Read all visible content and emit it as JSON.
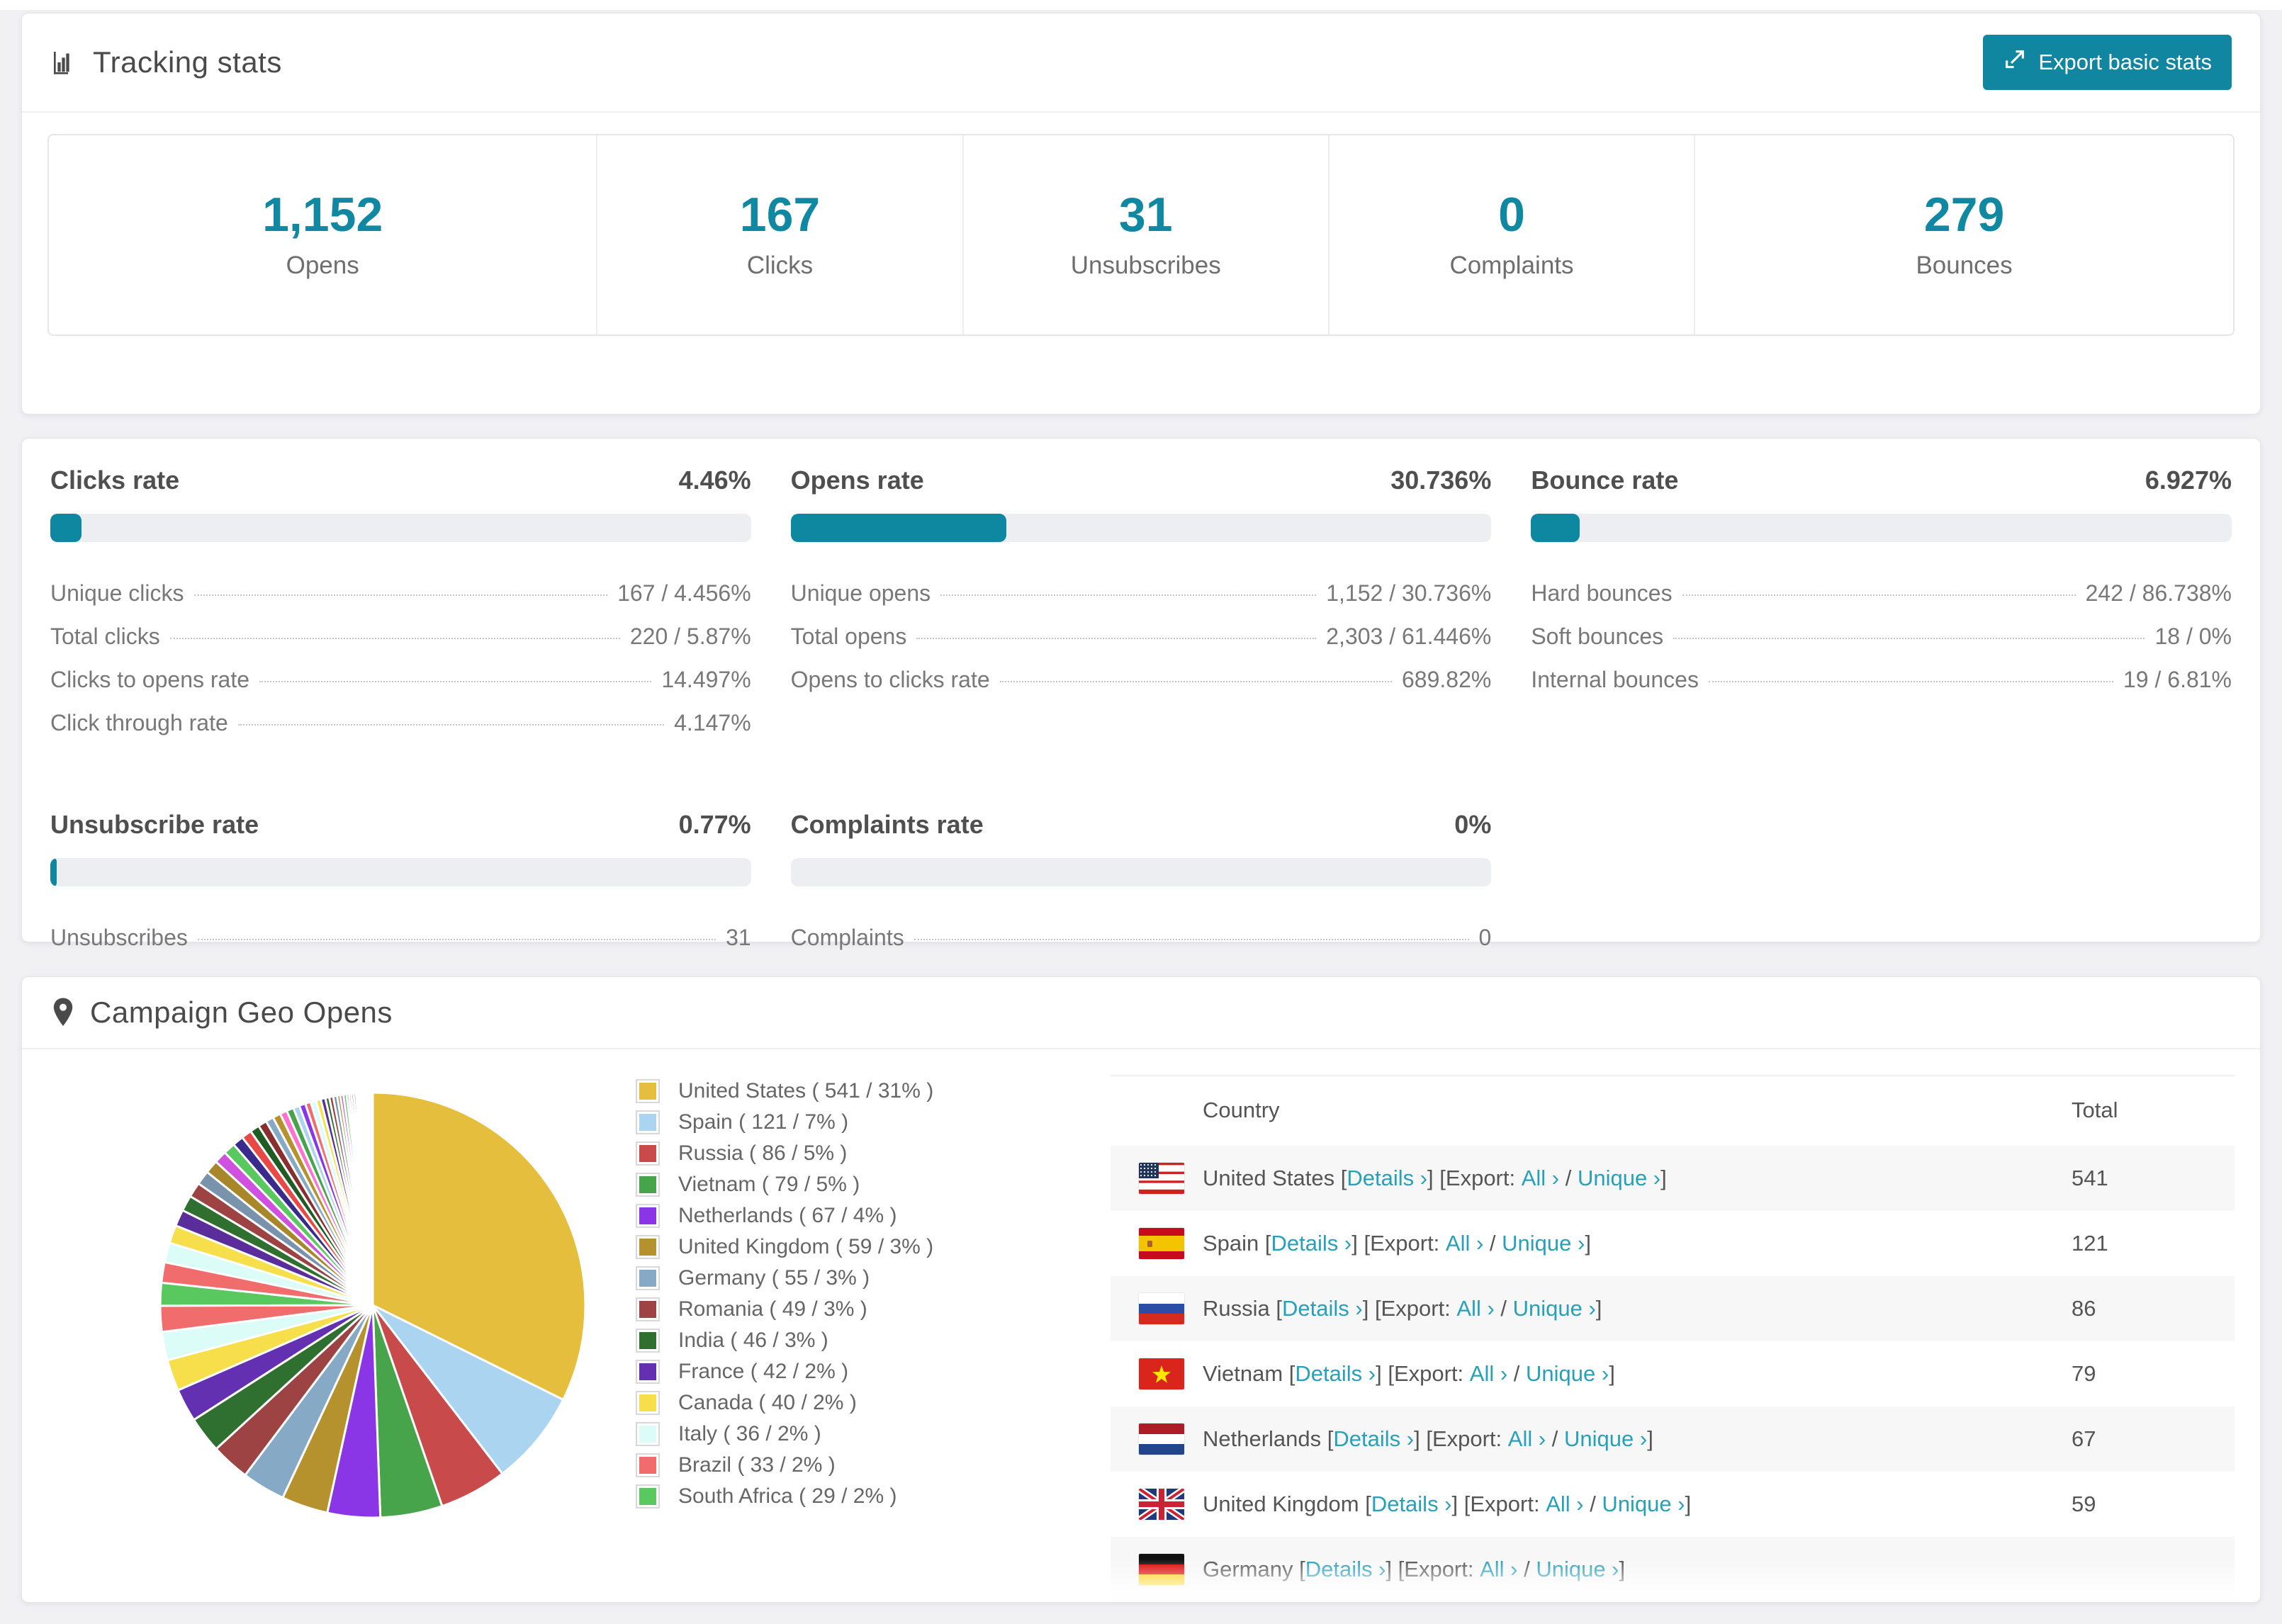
{
  "accent": "#1088a2",
  "tracking_card": {
    "title": "Tracking stats",
    "export_button": "Export basic stats",
    "summary": [
      {
        "value": "1,152",
        "label": "Opens"
      },
      {
        "value": "167",
        "label": "Clicks"
      },
      {
        "value": "31",
        "label": "Unsubscribes"
      },
      {
        "value": "0",
        "label": "Complaints"
      },
      {
        "value": "279",
        "label": "Bounces"
      }
    ]
  },
  "rates_card": {
    "panels": [
      {
        "title": "Clicks rate",
        "value": "4.46%",
        "bar_percent": 4.46,
        "rows": [
          {
            "label": "Unique clicks",
            "value": "167 / 4.456%"
          },
          {
            "label": "Total clicks",
            "value": "220 / 5.87%"
          },
          {
            "label": "Clicks to opens rate",
            "value": "14.497%"
          },
          {
            "label": "Click through rate",
            "value": "4.147%"
          }
        ]
      },
      {
        "title": "Opens rate",
        "value": "30.736%",
        "bar_percent": 30.736,
        "rows": [
          {
            "label": "Unique opens",
            "value": "1,152 / 30.736%"
          },
          {
            "label": "Total opens",
            "value": "2,303 / 61.446%"
          },
          {
            "label": "Opens to clicks rate",
            "value": "689.82%"
          }
        ]
      },
      {
        "title": "Bounce rate",
        "value": "6.927%",
        "bar_percent": 6.927,
        "rows": [
          {
            "label": "Hard bounces",
            "value": "242 / 86.738%"
          },
          {
            "label": "Soft bounces",
            "value": "18 / 0%"
          },
          {
            "label": "Internal bounces",
            "value": "19 / 6.81%"
          }
        ]
      },
      {
        "title": "Unsubscribe rate",
        "value": "0.77%",
        "bar_percent": 0.77,
        "rows": [
          {
            "label": "Unsubscribes",
            "value": "31"
          }
        ]
      },
      {
        "title": "Complaints rate",
        "value": "0%",
        "bar_percent": 0,
        "rows": [
          {
            "label": "Complaints",
            "value": "0"
          }
        ]
      }
    ]
  },
  "geo_card": {
    "title": "Campaign Geo Opens",
    "table": {
      "columns": {
        "country": "Country",
        "total": "Total"
      },
      "link_labels": {
        "lb": "[",
        "rb": "]",
        "details": "Details ›",
        "export": "[Export:",
        "all": "All ›",
        "slash": "/",
        "unique": "Unique ›"
      },
      "rows": [
        {
          "country": "United States",
          "flag": "us",
          "total": "541"
        },
        {
          "country": "Spain",
          "flag": "es",
          "total": "121"
        },
        {
          "country": "Russia",
          "flag": "ru",
          "total": "86"
        },
        {
          "country": "Vietnam",
          "flag": "vn",
          "total": "79"
        },
        {
          "country": "Netherlands",
          "flag": "nl",
          "total": "67"
        },
        {
          "country": "United Kingdom",
          "flag": "gb",
          "total": "59"
        },
        {
          "country": "Germany",
          "flag": "de",
          "total": ""
        }
      ]
    }
  },
  "chart_data": {
    "type": "pie",
    "title": "Campaign Geo Opens",
    "legend_position": "right",
    "start_angle_deg": -90,
    "direction": "clockwise",
    "slices": [
      {
        "label": "United States",
        "value": 541,
        "percent": 31,
        "color": "#e5be3d",
        "legend_label": "United States ( 541 / 31% )"
      },
      {
        "label": "Spain",
        "value": 121,
        "percent": 7,
        "color": "#abd4f1",
        "legend_label": "Spain ( 121 / 7% )"
      },
      {
        "label": "Russia",
        "value": 86,
        "percent": 5,
        "color": "#c84a4b",
        "legend_label": "Russia ( 86 / 5% )"
      },
      {
        "label": "Vietnam",
        "value": 79,
        "percent": 5,
        "color": "#47a44a",
        "legend_label": "Vietnam ( 79 / 5% )"
      },
      {
        "label": "Netherlands",
        "value": 67,
        "percent": 4,
        "color": "#8a35e6",
        "legend_label": "Netherlands ( 67 / 4% )"
      },
      {
        "label": "United Kingdom",
        "value": 59,
        "percent": 3,
        "color": "#b5922d",
        "legend_label": "United Kingdom ( 59 / 3% )"
      },
      {
        "label": "Germany",
        "value": 55,
        "percent": 3,
        "color": "#86a9c5",
        "legend_label": "Germany ( 55 / 3% )"
      },
      {
        "label": "Romania",
        "value": 49,
        "percent": 3,
        "color": "#9d4343",
        "legend_label": "Romania ( 49 / 3% )"
      },
      {
        "label": "India",
        "value": 46,
        "percent": 3,
        "color": "#2f7030",
        "legend_label": "India ( 46 / 3% )"
      },
      {
        "label": "France",
        "value": 42,
        "percent": 2,
        "color": "#6330b2",
        "legend_label": "France ( 42 / 2% )"
      },
      {
        "label": "Canada",
        "value": 40,
        "percent": 2,
        "color": "#f6df4b",
        "legend_label": "Canada ( 40 / 2% )"
      },
      {
        "label": "Italy",
        "value": 36,
        "percent": 2,
        "color": "#dcfcf7",
        "legend_label": "Italy ( 36 / 2% )"
      },
      {
        "label": "Brazil",
        "value": 33,
        "percent": 2,
        "color": "#f16c6c",
        "legend_label": "Brazil ( 33 / 2% )"
      },
      {
        "label": "South Africa",
        "value": 29,
        "percent": 2,
        "color": "#58c85f",
        "legend_label": "South Africa ( 29 / 2% )"
      }
    ],
    "tail_unlabeled_estimated_values": [
      26,
      25,
      23,
      21,
      20,
      19,
      18,
      17,
      16,
      15,
      14,
      13,
      12,
      11,
      10,
      10,
      9,
      9,
      8,
      8,
      7,
      7,
      6,
      6,
      5,
      5,
      5,
      4,
      4,
      4,
      3,
      3,
      3,
      3,
      2,
      2,
      2,
      2,
      2,
      1,
      1,
      1,
      1,
      1,
      1,
      1,
      1,
      1,
      1,
      1
    ],
    "tail_palette": [
      "#f16c6c",
      "#dcfcf7",
      "#f6df4b",
      "#5a2d9b",
      "#2f7030",
      "#9d4343",
      "#7a93ad",
      "#a8862a",
      "#d050e0",
      "#58c85f",
      "#3b2a8e",
      "#e84848",
      "#1f5c24",
      "#8a2f2f",
      "#86a9c5",
      "#b5922d",
      "#ff72d2",
      "#47a44a",
      "#abd4f1",
      "#8a35e6"
    ]
  }
}
